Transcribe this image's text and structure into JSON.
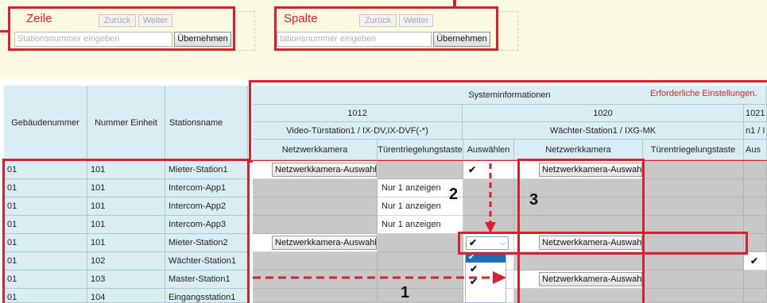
{
  "row_search": {
    "title": "Zeile",
    "back": "Zurück",
    "next": "Weiter",
    "placeholder": "Stationsnummer eingeben",
    "apply": "Übernehmen"
  },
  "col_search": {
    "title": "Spalte",
    "back": "Zurück",
    "next": "Weiter",
    "placeholder": "tationsnummer eingeben",
    "apply": "Übernehmen"
  },
  "table": {
    "col_headers": {
      "building": "Gebäudenummer",
      "unit": "Nummer Einheit",
      "name": "Stationsname"
    },
    "system_info": "Systeminformationen",
    "required": "Erforderliche Einstellungen.",
    "groups": [
      {
        "number": "1012",
        "type": "Video-Türstation1 / IX-DV,IX-DVF(-*)"
      },
      {
        "number": "1020",
        "type": "Wächter-Station1 / IXG-MK"
      },
      {
        "number": "1021",
        "type": "n1 / I"
      }
    ],
    "sub_headers": [
      "Netzwerkkamera",
      "Türentriegelungstaste",
      "Auswählen",
      "Netzwerkkamera",
      "Türentriegelungstaste",
      "Aus"
    ],
    "rows": [
      {
        "building": "01",
        "unit": "101",
        "name": "Mieter-Station1",
        "cam1": "Netzwerkkamera-Auswahl",
        "door1": "",
        "select": "✔",
        "cam2": "Netzwerkkamera-Auswah"
      },
      {
        "building": "01",
        "unit": "101",
        "name": "Intercom-App1",
        "cam1": "",
        "door1": "Nur 1 anzeigen",
        "select": "",
        "cam2": ""
      },
      {
        "building": "01",
        "unit": "101",
        "name": "Intercom-App2",
        "cam1": "",
        "door1": "Nur 1 anzeigen",
        "select": "",
        "cam2": ""
      },
      {
        "building": "01",
        "unit": "101",
        "name": "Intercom-App3",
        "cam1": "",
        "door1": "Nur 1 anzeigen",
        "select": "",
        "cam2": ""
      },
      {
        "building": "01",
        "unit": "101",
        "name": "Mieter-Station2",
        "cam1": "Netzwerkkamera-Auswahl",
        "door1": "",
        "select": "✔",
        "cam2": "Netzwerkkamera-Auswah"
      },
      {
        "building": "01",
        "unit": "102",
        "name": "Wächter-Station1",
        "cam1": "",
        "door1": "",
        "select": "✔",
        "cam2": ""
      },
      {
        "building": "01",
        "unit": "103",
        "name": "Master-Station1",
        "cam1": "",
        "door1": "",
        "select": "✔",
        "cam2": "Netzwerkkamera-Auswah"
      },
      {
        "building": "01",
        "unit": "104",
        "name": "Eingangsstation1",
        "cam1": "",
        "door1": "",
        "select": "✔",
        "cam2": ""
      }
    ],
    "far_check": "✔"
  },
  "callouts": {
    "one": "1",
    "two": "2",
    "three": "3"
  },
  "colors": {
    "highlight": "#d8212e",
    "header_bg": "#d9eef3",
    "panel_bg": "#fafae0",
    "dropdown_sel": "#1e6fb8"
  }
}
